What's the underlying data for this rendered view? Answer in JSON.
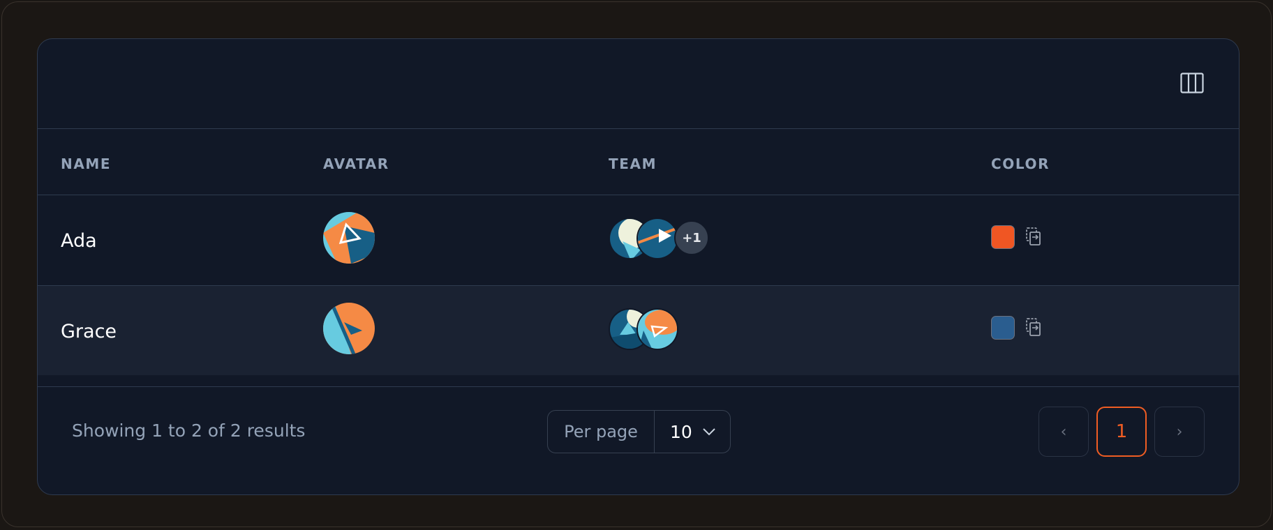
{
  "table": {
    "headers": {
      "name": "NAME",
      "avatar": "AVATAR",
      "team": "TEAM",
      "color": "COLOR"
    },
    "rows": [
      {
        "name": "Ada",
        "team_extra": "+1",
        "color": "#f05623"
      },
      {
        "name": "Grace",
        "color": "#2a5d8f"
      }
    ]
  },
  "footer": {
    "summary": "Showing 1 to 2 of 2 results",
    "per_page_label": "Per page",
    "per_page_value": "10",
    "prev": "‹",
    "current_page": "1",
    "next": "›"
  },
  "icons": {
    "toolbar": "columns-icon",
    "copy": "copy-icon",
    "select": "chevron-down-icon"
  },
  "colors": {
    "accent": "#f05d23",
    "card_bg": "#111827",
    "row_alt_bg": "#1a2232",
    "muted_text": "#94a3b8"
  }
}
